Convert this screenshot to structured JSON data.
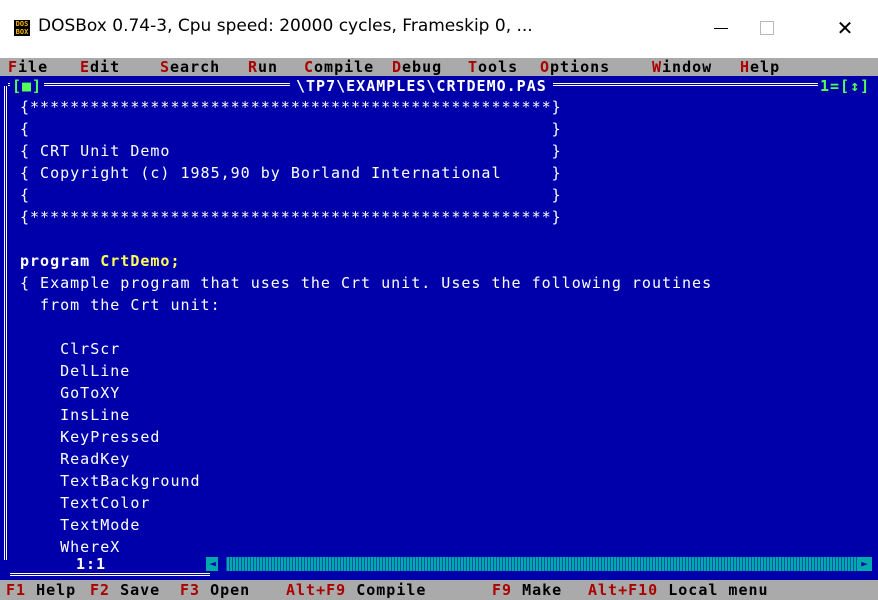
{
  "window": {
    "title": "DOSBox 0.74-3, Cpu speed:   20000 cycles, Frameskip  0, ...",
    "icon_text": "DOS BOX",
    "close_glyph": "✕"
  },
  "menu": [
    {
      "hot": "F",
      "rest": "ile"
    },
    {
      "hot": "E",
      "rest": "dit"
    },
    {
      "hot": "S",
      "rest": "earch"
    },
    {
      "hot": "R",
      "rest": "un"
    },
    {
      "hot": "C",
      "rest": "ompile"
    },
    {
      "hot": "D",
      "rest": "ebug"
    },
    {
      "hot": "T",
      "rest": "ools"
    },
    {
      "hot": "O",
      "rest": "ptions"
    },
    {
      "hot": "W",
      "rest": "indow"
    },
    {
      "hot": "H",
      "rest": "elp"
    }
  ],
  "editor_window": {
    "close_box": "[■]",
    "file_path": "\\TP7\\EXAMPLES\\CRTDEMO.PAS",
    "window_number": "1=[↕]",
    "cursor_position": "1:1"
  },
  "code": [
    "{****************************************************}",
    "{                                                    }",
    "{ CRT Unit Demo                                      }",
    "{ Copyright (c) 1985,90 by Borland International     }",
    "{                                                    }",
    "{****************************************************}",
    "",
    "program CrtDemo;",
    "{ Example program that uses the Crt unit. Uses the following routines",
    "  from the Crt unit:",
    "",
    "    ClrScr",
    "    DelLine",
    "    GoToXY",
    "    InsLine",
    "    KeyPressed",
    "    ReadKey",
    "    TextBackground",
    "    TextColor",
    "    TextMode",
    "    WhereX"
  ],
  "status": [
    {
      "key": "F1",
      "label": "Help"
    },
    {
      "key": "F2",
      "label": "Save"
    },
    {
      "key": "F3",
      "label": "Open"
    },
    {
      "key": "Alt+F9",
      "label": "Compile"
    },
    {
      "key": "F9",
      "label": "Make"
    },
    {
      "key": "Alt+F10",
      "label": "Local menu"
    }
  ],
  "colors": {
    "dos_blue": "#0000aa",
    "menu_gray": "#aaaaaa",
    "hotkey_red": "#aa0000",
    "scroll_cyan": "#00aaaa",
    "highlight_yellow": "#ffff55",
    "frame_green": "#55ff55"
  }
}
